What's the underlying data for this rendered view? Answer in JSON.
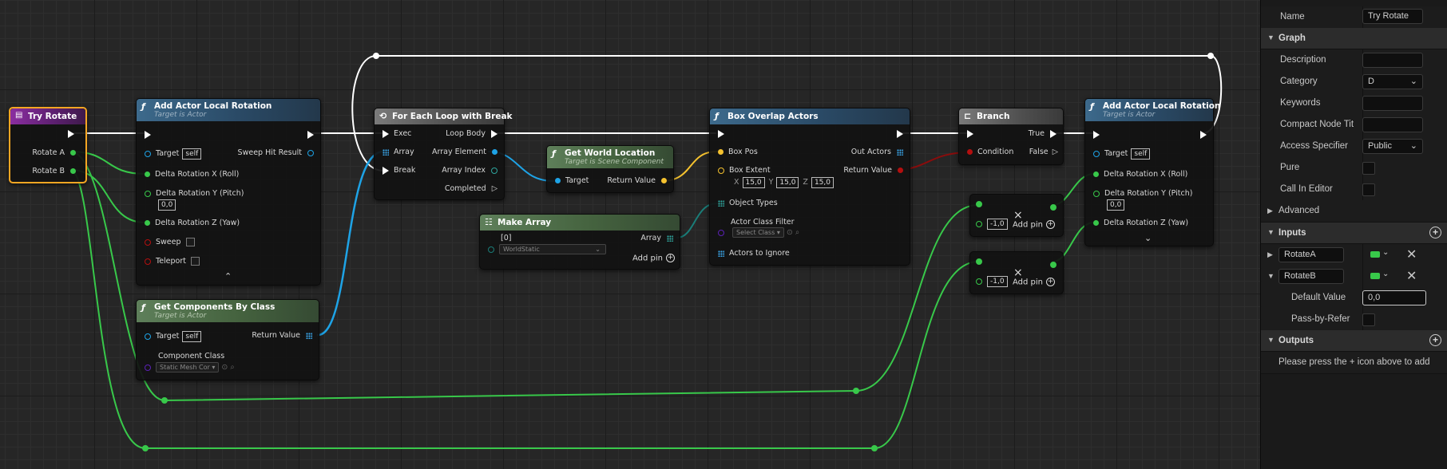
{
  "graph": {
    "event_node": {
      "title": "Try Rotate",
      "pins": [
        "Rotate A",
        "Rotate B"
      ]
    },
    "add_rotation_1": {
      "title": "Add Actor Local Rotation",
      "subtitle": "Target is Actor",
      "target": "Target",
      "target_value": "self",
      "sweep_hit": "Sweep Hit Result",
      "roll": "Delta Rotation X (Roll)",
      "pitch": "Delta Rotation Y (Pitch)",
      "pitch_value": "0,0",
      "yaw": "Delta Rotation Z (Yaw)",
      "sweep": "Sweep",
      "teleport": "Teleport"
    },
    "get_components": {
      "title": "Get Components By Class",
      "subtitle": "Target is Actor",
      "target": "Target",
      "target_value": "self",
      "return_value": "Return Value",
      "component_class": "Component Class",
      "class_value": "Static Mesh Cor"
    },
    "foreach": {
      "title": "For Each Loop with Break",
      "exec": "Exec",
      "array": "Array",
      "break": "Break",
      "loop_body": "Loop Body",
      "array_element": "Array Element",
      "array_index": "Array Index",
      "completed": "Completed"
    },
    "get_world_location": {
      "title": "Get World Location",
      "subtitle": "Target is Scene Component",
      "target": "Target",
      "return_value": "Return Value"
    },
    "make_array": {
      "title": "Make Array",
      "index_label": "[0]",
      "index_value": "WorldStatic",
      "array": "Array",
      "add_pin": "Add pin"
    },
    "box_overlap": {
      "title": "Box Overlap Actors",
      "box_pos": "Box Pos",
      "box_extent": "Box Extent",
      "x_label": "X",
      "x": "15,0",
      "y_label": "Y",
      "y": "15,0",
      "z_label": "Z",
      "z": "15,0",
      "object_types": "Object Types",
      "actor_class_filter": "Actor Class Filter",
      "select_class": "Select Class",
      "actors_to_ignore": "Actors to Ignore",
      "out_actors": "Out Actors",
      "return_value": "Return Value"
    },
    "branch": {
      "title": "Branch",
      "condition": "Condition",
      "true_label": "True",
      "false_label": "False"
    },
    "multiply_1": {
      "value": "-1,0",
      "add_pin": "Add pin"
    },
    "multiply_2": {
      "value": "-1,0",
      "add_pin": "Add pin"
    },
    "add_rotation_2": {
      "title": "Add Actor Local Rotation",
      "subtitle": "Target is Actor",
      "target": "Target",
      "target_value": "self",
      "roll": "Delta Rotation X (Roll)",
      "pitch": "Delta Rotation Y (Pitch)",
      "pitch_value": "0,0",
      "yaw": "Delta Rotation Z (Yaw)"
    }
  },
  "details": {
    "name_label": "Name",
    "name_value": "Try Rotate",
    "graph_section": "Graph",
    "description": "Description",
    "category": "Category",
    "category_value": "D",
    "keywords": "Keywords",
    "compact_node_title": "Compact Node Tit",
    "access_specifier": "Access Specifier",
    "access_value": "Public",
    "pure": "Pure",
    "call_in_editor": "Call In Editor",
    "advanced": "Advanced",
    "inputs_section": "Inputs",
    "input_a": "RotateA",
    "input_b": "RotateB",
    "default_value_label": "Default Value",
    "default_value": "0,0",
    "pass_by_ref": "Pass-by-Refer",
    "outputs_section": "Outputs",
    "outputs_hint": "Please press the + icon above to add"
  },
  "colors": {
    "exec": "#ffffff",
    "float": "#38c84a",
    "object": "#1ea3e6",
    "vector": "#f5c22f",
    "bool": "#b40f0f",
    "class": "#5b21b6",
    "event_outline": "#f5a623"
  }
}
